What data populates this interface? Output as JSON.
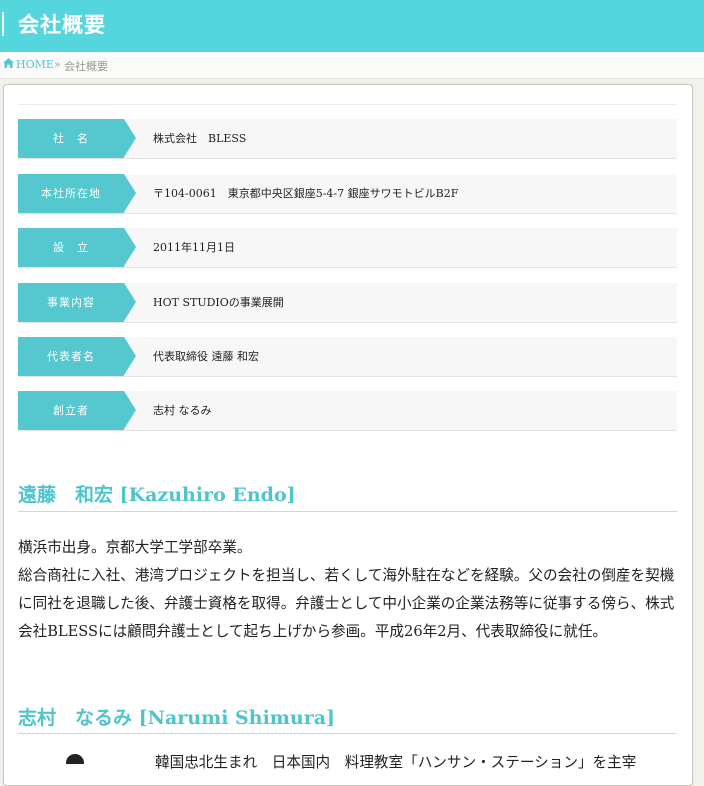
{
  "header": {
    "title": "会社概要"
  },
  "breadcrumb": {
    "home": "HOME",
    "separator": "»",
    "current": "会社概要"
  },
  "company_info": [
    {
      "label": "社　名",
      "value": "株式会社　BLESS"
    },
    {
      "label": "本社所在地",
      "value": "〒104-0061　東京都中央区銀座5-4-7 銀座サワモトビルB2F"
    },
    {
      "label": "設　立",
      "value": "2011年11月1日"
    },
    {
      "label": "事業内容",
      "value": "HOT STUDIOの事業展開"
    },
    {
      "label": "代表者名",
      "value": "代表取締役 遠藤 和宏"
    },
    {
      "label": "創立者",
      "value": "志村 なるみ"
    }
  ],
  "people": [
    {
      "name": "遠藤　和宏 [Kazuhiro Endo]",
      "bio": [
        "横浜市出身。京都大学工学部卒業。",
        "総合商社に入社、港湾プロジェクトを担当し、若くして海外駐在などを経験。父の会社の倒産を契機に同社を退職した後、弁護士資格を取得。弁護士として中小企業の企業法務等に従事する傍ら、株式会社BLESSには顧問弁護士として起ち上げから参画。平成26年2月、代表取締役に就任。"
      ]
    },
    {
      "name": "志村　なるみ [Narumi Shimura]",
      "bio": [
        "韓国忠北生まれ　日本国内　料理教室「ハンサン・ステーション」を主宰"
      ]
    }
  ],
  "colors": {
    "accent": "#55d6de",
    "label_bg": "#55c7cf",
    "name_text": "#4fc4cc"
  },
  "icons": {
    "home": "home-icon"
  }
}
